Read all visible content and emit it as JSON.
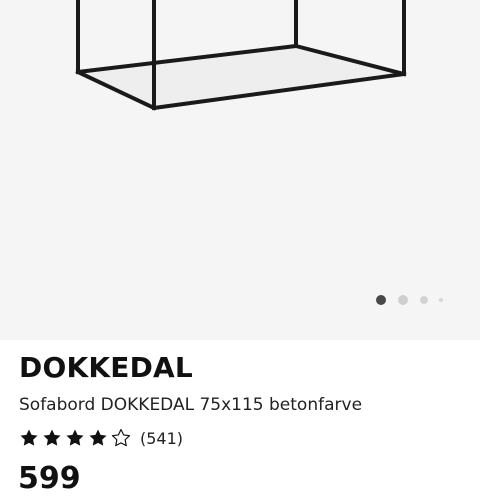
{
  "product": {
    "image": {
      "carousel_page": 1,
      "carousel_total": 4
    },
    "brand": "DOKKEDAL",
    "description": "Sofabord DOKKEDAL 75x115 betonfarve",
    "rating": {
      "value": 4,
      "max": 5,
      "count_text": "(541)"
    },
    "price": "599",
    "colors": {
      "image_background": "#f5f5f5",
      "frame": "#1a1a1a",
      "star_filled": "#111111",
      "dot_active": "#484848",
      "dot_inactive": "#cfcfcf"
    }
  }
}
